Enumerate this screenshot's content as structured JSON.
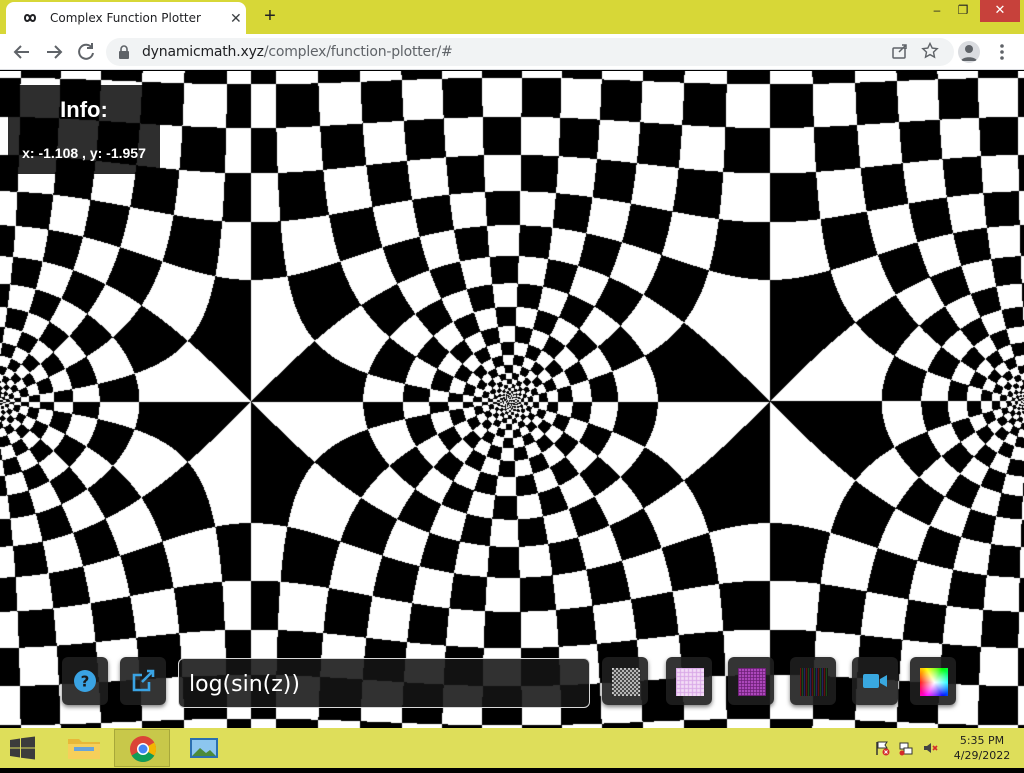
{
  "browser": {
    "tab_title": "Complex Function Plotter",
    "tab_close": "✕",
    "new_tab": "+",
    "url_host": "dynamicmath.xyz",
    "url_path": "/complex/function-plotter/#",
    "window_controls": {
      "minimize": "–",
      "maximize": "❐",
      "close": "✕"
    },
    "theme": {
      "frame": "#d7d737",
      "close_bg": "#c7413b"
    }
  },
  "info": {
    "title": "Info:",
    "coords": "x: -1.108 , y: -1.957"
  },
  "controls": {
    "expression": "log(sin(z))",
    "help_icon": "help-circle-icon",
    "export_icon": "external-link-icon",
    "texture_icons": [
      "checker-texture-icon",
      "pink-grid-texture-icon",
      "magenta-grid-texture-icon",
      "dark-stripes-texture-icon"
    ],
    "video_icon": "video-camera-icon",
    "color_icon": "color-wheel-icon",
    "accent_help": "#3aa3e3",
    "accent_video": "#39a8e0"
  },
  "taskbar": {
    "time": "5:35 PM",
    "date": "4/29/2022",
    "color": "#dede5a"
  }
}
